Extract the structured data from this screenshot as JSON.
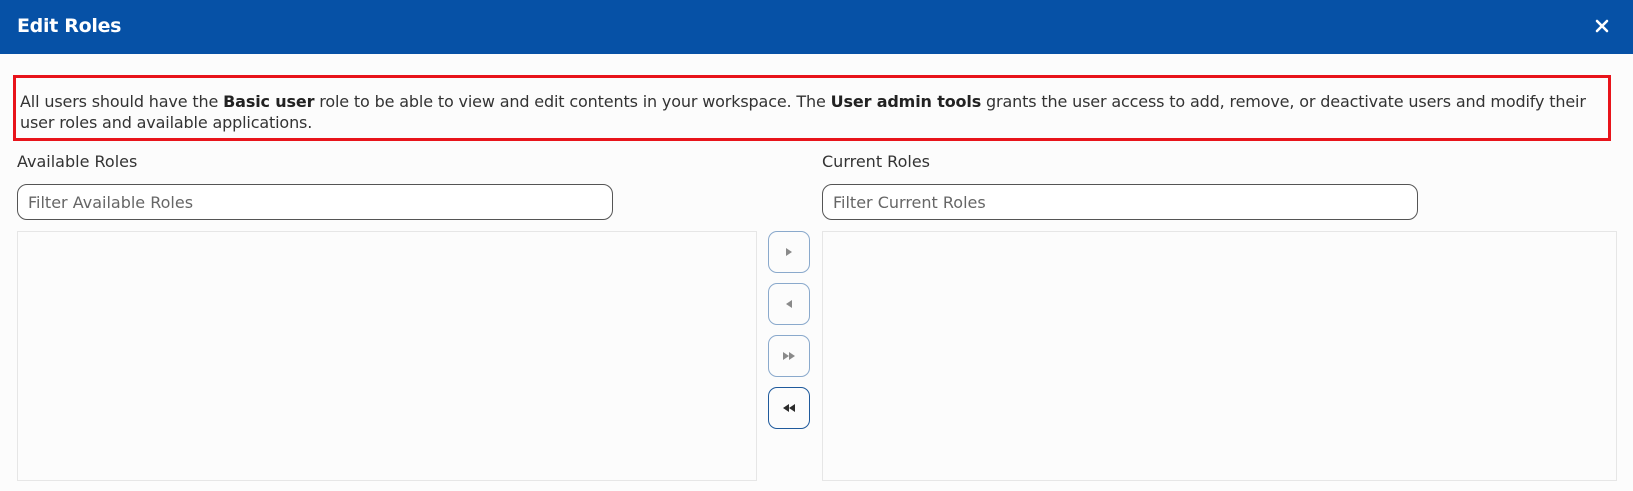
{
  "dialog": {
    "title": "Edit Roles",
    "close_icon": "close-icon",
    "accent_color": "#0651a6",
    "highlight_color": "#e8141b"
  },
  "notice": {
    "part1": "All users should have the ",
    "bold1": "Basic user",
    "part2": " role to be able to view and edit contents in your workspace. The ",
    "bold2": "User admin tools",
    "part3": " grants the user access to add, remove, or deactivate users and modify their user roles and available applications."
  },
  "available": {
    "label": "Available Roles",
    "filter_placeholder": "Filter Available Roles",
    "items": []
  },
  "current": {
    "label": "Current Roles",
    "filter_placeholder": "Filter Current Roles",
    "items": []
  },
  "move_buttons": [
    {
      "icon": "move-right-icon"
    },
    {
      "icon": "move-left-icon"
    },
    {
      "icon": "move-all-right-icon"
    },
    {
      "icon": "move-all-left-icon"
    }
  ]
}
